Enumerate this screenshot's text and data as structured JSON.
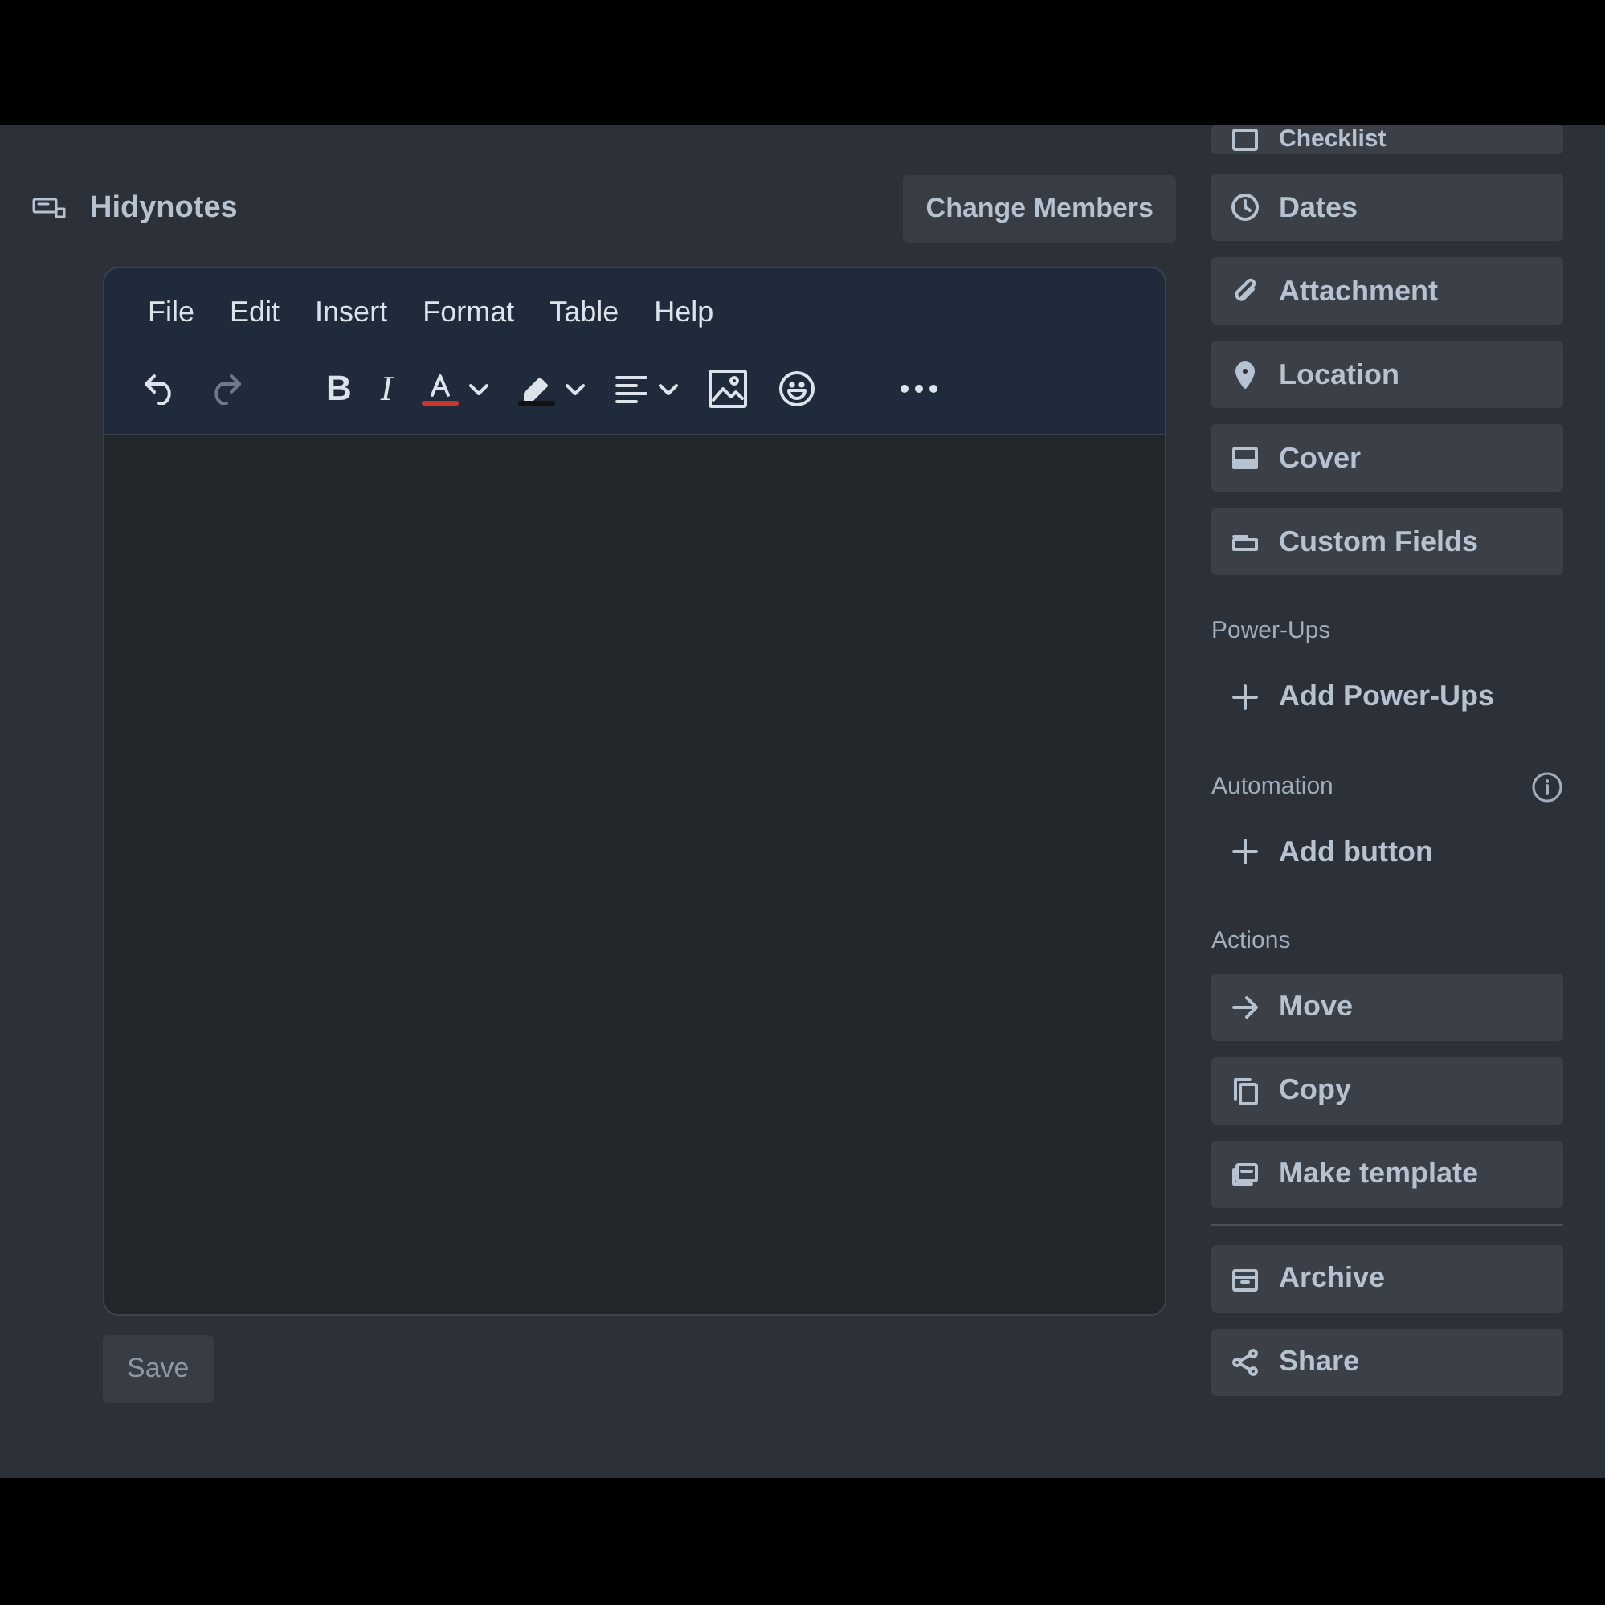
{
  "card": {
    "title": "Hidynotes",
    "change_members": "Change Members"
  },
  "editor": {
    "menu": [
      "File",
      "Edit",
      "Insert",
      "Format",
      "Table",
      "Help"
    ],
    "toolbar": [
      {
        "kind": "undo",
        "disabled": false
      },
      {
        "kind": "redo",
        "disabled": true
      },
      {
        "kind": "bold",
        "label": "B",
        "disabled": false
      },
      {
        "kind": "italic",
        "label": "I",
        "disabled": false
      },
      {
        "kind": "text-color",
        "disabled": false
      },
      {
        "kind": "highlight",
        "disabled": false
      },
      {
        "kind": "align",
        "disabled": false
      },
      {
        "kind": "image",
        "disabled": false
      },
      {
        "kind": "emoji",
        "disabled": false
      },
      {
        "kind": "more",
        "disabled": false
      }
    ]
  },
  "save": "Save",
  "sidebar": {
    "buttons": [
      {
        "kind": "checklist",
        "label": "Checklist"
      },
      {
        "kind": "dates",
        "label": "Dates"
      },
      {
        "kind": "attachment",
        "label": "Attachment"
      },
      {
        "kind": "location",
        "label": "Location"
      },
      {
        "kind": "cover",
        "label": "Cover"
      },
      {
        "kind": "fields",
        "label": "Custom Fields"
      }
    ],
    "sections": [
      {
        "title": "Power-Ups",
        "info": false,
        "buttons": [
          {
            "kind": "add",
            "label": "Add Power-Ups"
          }
        ]
      },
      {
        "title": "Automation",
        "info": true,
        "buttons": [
          {
            "kind": "add",
            "label": "Add button"
          }
        ]
      },
      {
        "title": "Actions",
        "info": false,
        "buttons": [
          {
            "kind": "move",
            "label": "Move"
          },
          {
            "kind": "copy",
            "label": "Copy"
          },
          {
            "kind": "template",
            "label": "Make template"
          }
        ],
        "buttons_after_divider": [
          {
            "kind": "archive",
            "label": "Archive"
          },
          {
            "kind": "share",
            "label": "Share"
          }
        ]
      }
    ]
  }
}
